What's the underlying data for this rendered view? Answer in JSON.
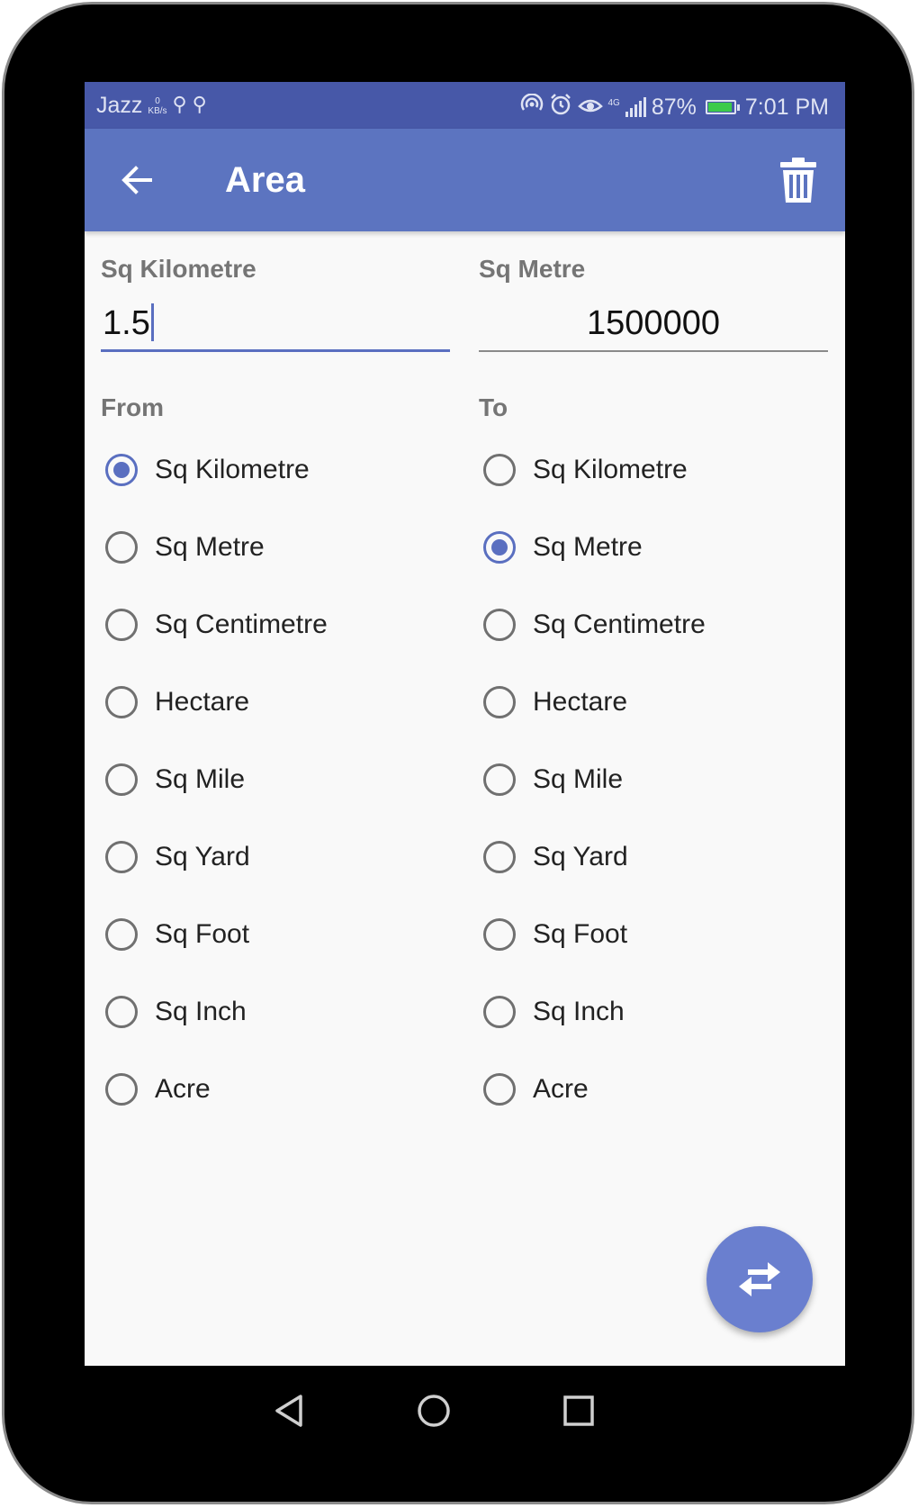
{
  "status_bar": {
    "carrier": "Jazz",
    "speed_value": "0",
    "speed_unit": "KB/s",
    "network": "4G",
    "battery_percent": "87%",
    "time": "7:01 PM"
  },
  "app_bar": {
    "title": "Area",
    "back_icon": "arrow-left-icon",
    "delete_icon": "trash-icon"
  },
  "from": {
    "unit_label": "Sq Kilometre",
    "value": "1.5",
    "group_label": "From",
    "selected": "Sq Kilometre"
  },
  "to": {
    "unit_label": "Sq Metre",
    "value": "1500000",
    "group_label": "To",
    "selected": "Sq Metre"
  },
  "units": [
    {
      "label": "Sq Kilometre"
    },
    {
      "label": "Sq Metre"
    },
    {
      "label": "Sq Centimetre"
    },
    {
      "label": "Hectare"
    },
    {
      "label": "Sq Mile"
    },
    {
      "label": "Sq Yard"
    },
    {
      "label": "Sq Foot"
    },
    {
      "label": "Sq Inch"
    },
    {
      "label": "Acre"
    }
  ],
  "fab": {
    "icon": "swap-icon"
  },
  "colors": {
    "status_bar": "#4758a8",
    "app_bar": "#5c74c0",
    "accent": "#5a6fc0",
    "fab": "#6a7fcf"
  }
}
